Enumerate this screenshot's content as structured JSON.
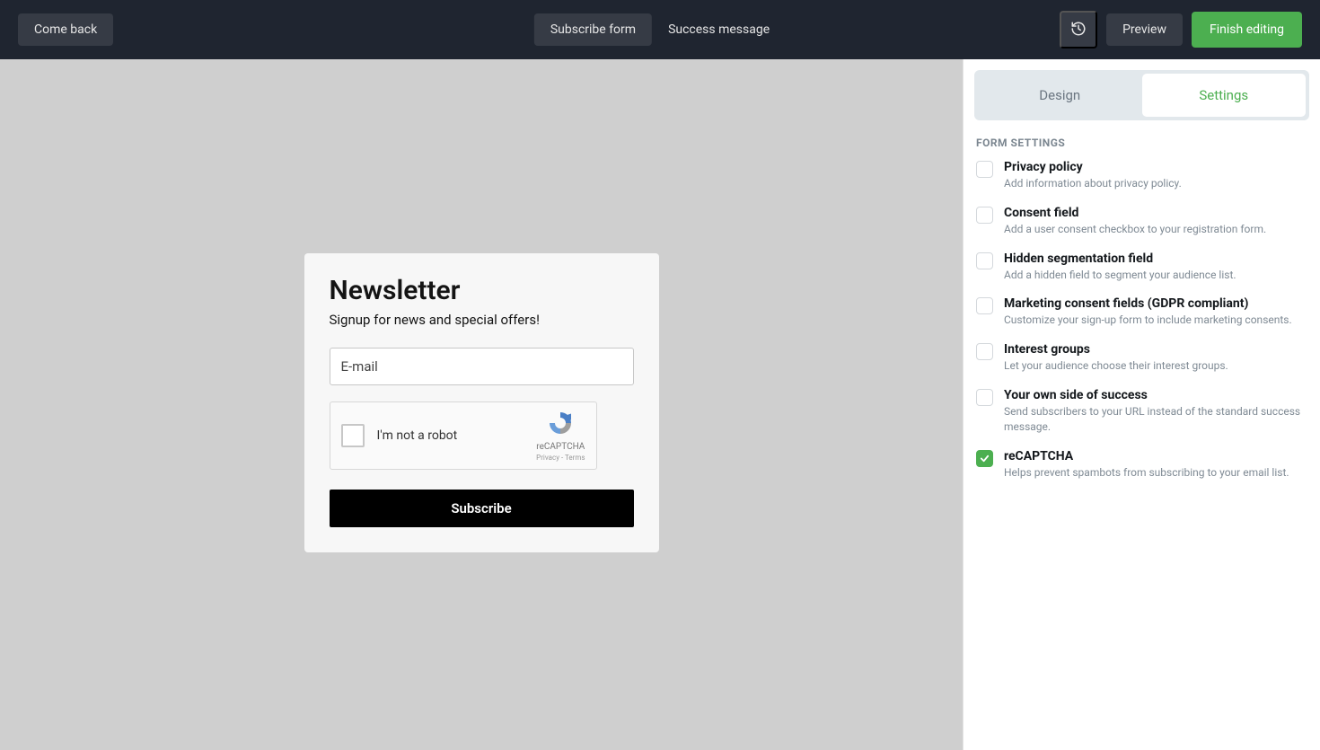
{
  "header": {
    "back_label": "Come back",
    "tabs": {
      "subscribe_form": "Subscribe form",
      "success_message": "Success message"
    },
    "preview_label": "Preview",
    "finish_label": "Finish editing"
  },
  "newsletter": {
    "title": "Newsletter",
    "subtitle": "Signup for news and special offers!",
    "email_placeholder": "E-mail",
    "recaptcha_label": "I'm not a robot",
    "recaptcha_name": "reCAPTCHA",
    "recaptcha_links": "Privacy - Terms",
    "subscribe_label": "Subscribe"
  },
  "sidebar": {
    "panel_tabs": {
      "design": "Design",
      "settings": "Settings"
    },
    "section_heading": "FORM SETTINGS",
    "settings": [
      {
        "title": "Privacy policy",
        "desc": "Add information about privacy policy.",
        "checked": false
      },
      {
        "title": "Consent field",
        "desc": "Add a user consent checkbox to your registration form.",
        "checked": false
      },
      {
        "title": "Hidden segmentation field",
        "desc": "Add a hidden field to segment your audience list.",
        "checked": false
      },
      {
        "title": "Marketing consent fields (GDPR compliant)",
        "desc": "Customize your sign-up form to include marketing consents.",
        "checked": false
      },
      {
        "title": "Interest groups",
        "desc": "Let your audience choose their interest groups.",
        "checked": false
      },
      {
        "title": "Your own side of success",
        "desc": "Send subscribers to your URL instead of the standard success message.",
        "checked": false
      },
      {
        "title": "reCAPTCHA",
        "desc": "Helps prevent spambots from subscribing to your email list.",
        "checked": true
      }
    ]
  }
}
